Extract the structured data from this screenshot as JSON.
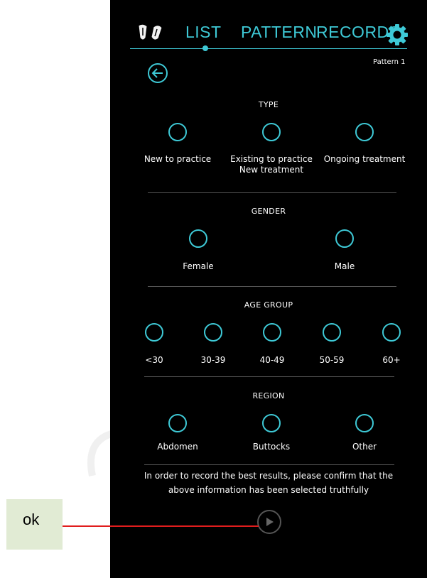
{
  "nav": {
    "tabs": [
      {
        "label": "LIST",
        "active": true
      },
      {
        "label": "PATTERN",
        "active": false
      },
      {
        "label": "RECORDS",
        "active": false
      }
    ],
    "left_icon": "two-probes-icon",
    "settings_icon": "gear-icon",
    "accent_color": "#3ec9d6"
  },
  "header": {
    "back_icon": "back-arrow-icon",
    "pattern_label": "Pattern 1"
  },
  "sections": {
    "type": {
      "title": "TYPE",
      "options": [
        "New to practice",
        "Existing to practice\nNew treatment",
        "Ongoing treatment"
      ]
    },
    "gender": {
      "title": "GENDER",
      "options": [
        "Female",
        "Male"
      ]
    },
    "age_group": {
      "title": "AGE GROUP",
      "options": [
        "<30",
        "30-39",
        "40-49",
        "50-59",
        "60+"
      ]
    },
    "region": {
      "title": "REGION",
      "options": [
        "Abdomen",
        "Buttocks",
        "Other"
      ]
    }
  },
  "notice": {
    "line1": "In order to record the best results, please confirm that the",
    "line2": "above information has been selected truthfully"
  },
  "play_icon": "play-icon",
  "annotation": {
    "label": "ok",
    "line_color": "#e01d1d",
    "box_color": "#e1ebd4"
  }
}
